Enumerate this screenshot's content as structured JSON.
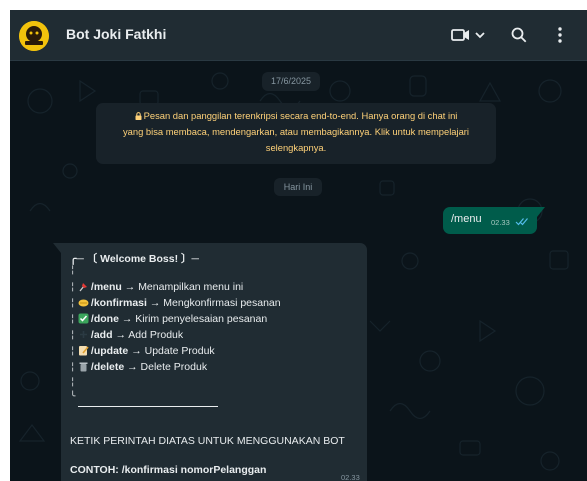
{
  "header": {
    "chat_name": "Bot Joki Fatkhi"
  },
  "chat": {
    "date_chip": "17/6/2025",
    "encryption_notice": {
      "line1": "Pesan dan panggilan terenkripsi secara end-to-end. Hanya orang di chat ini",
      "line2": "yang bisa membaca, mendengarkan, atau membagikannya. Klik untuk mempelajari",
      "line3": "selengkapnya."
    },
    "today_chip": "Hari Ini",
    "outgoing": {
      "text": "/menu",
      "time": "02.33"
    },
    "incoming": {
      "heading": "╭─ 〔 Welcome Boss! 〕─",
      "commands": [
        {
          "cmd": "/menu",
          "arrow": "→",
          "desc": "Menampilkan menu ini",
          "icon": "pin-icon"
        },
        {
          "cmd": "/konfirmasi",
          "arrow": "→",
          "desc": "Mengkonfirmasi pesanan",
          "icon": "handshake-icon"
        },
        {
          "cmd": "/done",
          "arrow": "→",
          "desc": "Kirim penyelesaian pesanan",
          "icon": "check-box-icon"
        },
        {
          "cmd": "/add",
          "arrow": "→",
          "desc": "Add Produk",
          "icon": "plus-icon"
        },
        {
          "cmd": "/update",
          "arrow": "→",
          "desc": "Update Produk",
          "icon": "memo-icon"
        },
        {
          "cmd": "/delete",
          "arrow": "→",
          "desc": "Delete Produk",
          "icon": "trash-icon"
        }
      ],
      "instruction": "KETIK PERINTAH DIATAS UNTUK MENGGUNAKAN BOT",
      "example": "CONTOH: /konfirmasi nomorPelanggan",
      "time": "02.33"
    }
  },
  "colors": {
    "background": "#0b141a",
    "header": "#202c33",
    "outgoing_bubble": "#005c4b",
    "incoming_bubble": "#202c33",
    "notice_text": "#ffd279",
    "read_tick": "#53bdeb"
  }
}
